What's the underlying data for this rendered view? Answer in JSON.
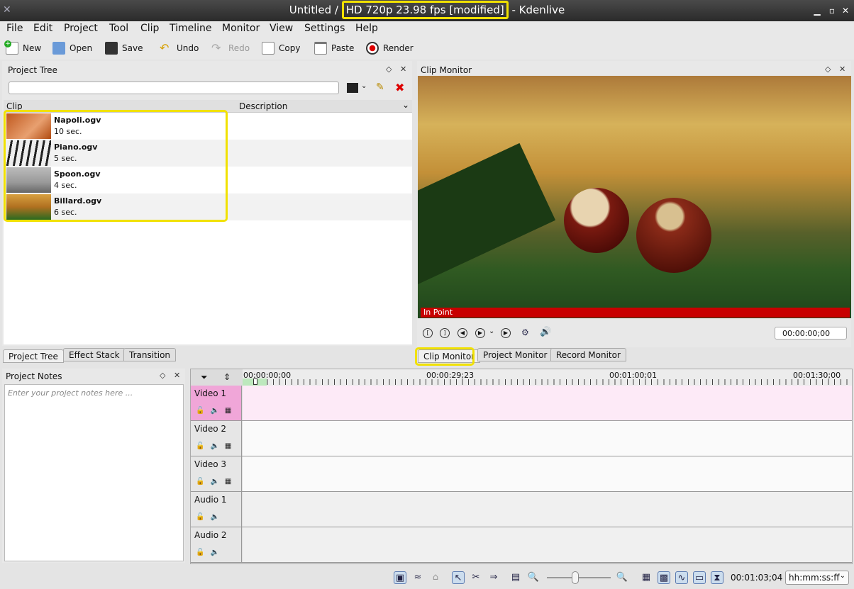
{
  "window": {
    "title_prefix": "Untitled / ",
    "title_highlight": "HD 720p 23.98 fps [modified]",
    "title_suffix": " - Kdenlive",
    "buttons": [
      "minimize",
      "maximize",
      "close"
    ]
  },
  "menu": [
    "File",
    "Edit",
    "Project",
    "Tool",
    "Clip",
    "Timeline",
    "Monitor",
    "View",
    "Settings",
    "Help"
  ],
  "toolbar": {
    "new": "New",
    "open": "Open",
    "save": "Save",
    "undo": "Undo",
    "redo": "Redo",
    "copy": "Copy",
    "paste": "Paste",
    "render": "Render"
  },
  "project_tree": {
    "title": "Project Tree",
    "search_placeholder": "",
    "col_clip": "Clip",
    "col_desc": "Description",
    "clips": [
      {
        "name": "Napoli.ogv",
        "duration": "10 sec."
      },
      {
        "name": "Piano.ogv",
        "duration": "5 sec."
      },
      {
        "name": "Spoon.ogv",
        "duration": "4 sec."
      },
      {
        "name": "Billard.ogv",
        "duration": "6 sec."
      }
    ]
  },
  "left_tabs": [
    "Project Tree",
    "Effect Stack",
    "Transition"
  ],
  "clip_monitor": {
    "title": "Clip Monitor",
    "marker": "In Point",
    "timecode": "00:00:00;00"
  },
  "monitor_tabs": [
    "Clip Monitor",
    "Project Monitor",
    "Record Monitor"
  ],
  "notes": {
    "title": "Project Notes",
    "placeholder": "Enter your project notes here ..."
  },
  "timeline": {
    "ruler": [
      "00:00:00;00",
      "00:00:29;23",
      "00:01:00;01",
      "00:01:30;00"
    ],
    "tracks": [
      "Video 1",
      "Video 2",
      "Video 3",
      "Audio 1",
      "Audio 2"
    ]
  },
  "status": {
    "timecode": "00:01:03;04",
    "format": "hh:mm:ss:ff"
  },
  "colors": {
    "highlight": "#f1e100",
    "selected_track": "#f0a6d8",
    "in_point": "#c80000"
  }
}
